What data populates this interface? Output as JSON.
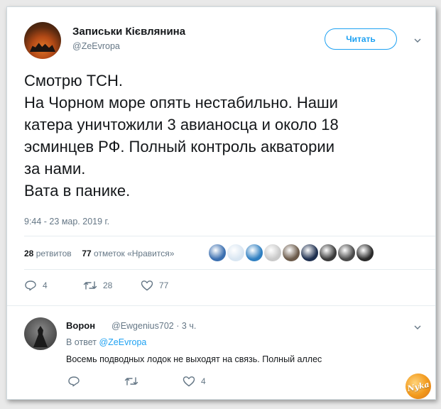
{
  "tweet": {
    "author_name": "Записьки Кієвлянина",
    "author_handle": "@ZeEvropa",
    "follow_label": "Читать",
    "text_lines": [
      "Смотрю ТСН.",
      "На Чорном море опять нестабильно. Наши",
      "катера уничтожили 3 авианосца и около 18",
      "эсминцев РФ. Полный контроль акватории",
      "за нами.",
      "Вата в панике."
    ],
    "timestamp": "9:44 - 23 мар. 2019 г.",
    "stats": {
      "retweets_count": "28",
      "retweets_label": "ретвитов",
      "likes_count": "77",
      "likes_label": "отметок «Нравится»"
    },
    "actions": {
      "replies": "4",
      "retweets": "28",
      "likes": "77"
    },
    "likers": [
      {
        "color": "#3b6fb0"
      },
      {
        "color": "#d9e6f2"
      },
      {
        "color": "#2f7fc1"
      },
      {
        "color": "#c9c9c9"
      },
      {
        "color": "#6b5a4a"
      },
      {
        "color": "#1e2f4f"
      },
      {
        "color": "#3a3a3a"
      },
      {
        "color": "#4a4a4a"
      },
      {
        "color": "#2a2a2a"
      }
    ]
  },
  "reply": {
    "author_name": "Ворон",
    "author_handle": "@Ewgenius702",
    "time": "3 ч.",
    "in_reply_prefix": "В ответ",
    "in_reply_handle": "@ZeEvropa",
    "text": "Восемь подводных лодок не выходят на связь. Полный аллес",
    "actions": {
      "likes": "4"
    }
  },
  "watermark": {
    "text": "Nyka"
  },
  "colors": {
    "accent": "#1da1f2",
    "muted": "#657786",
    "text": "#14171a",
    "divider": "#e6ecf0"
  },
  "icons": {
    "caret": "chevron-down-icon",
    "reply": "reply-icon",
    "retweet": "retweet-icon",
    "like": "heart-icon"
  }
}
